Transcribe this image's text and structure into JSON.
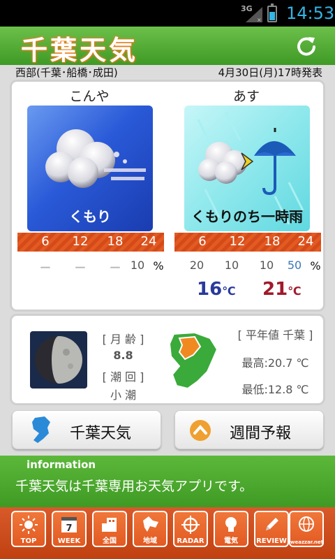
{
  "status_bar": {
    "network": "3G",
    "time": "14:53"
  },
  "header": {
    "title": "千葉天気",
    "refresh_icon": "refresh-icon"
  },
  "info_line": {
    "region": "西部(千葉･船橋･成田)",
    "issued": "4月30日(月)17時発表"
  },
  "forecast": {
    "today": {
      "label": "こんや",
      "weather": "くもり",
      "times": [
        "6",
        "12",
        "18",
        "24"
      ],
      "precip": [
        "ー",
        "ー",
        "ー",
        "10"
      ],
      "pct_unit": "%"
    },
    "tomorrow": {
      "label": "あす",
      "weather": "くもりのち一時雨",
      "times": [
        "6",
        "12",
        "18",
        "24"
      ],
      "precip": [
        "20",
        "10",
        "10",
        "50"
      ],
      "pct_unit": "%",
      "min_temp": "16",
      "max_temp": "21",
      "temp_unit": "℃"
    }
  },
  "moon": {
    "age_label": "[ 月 齢 ]",
    "age_value": "8.8",
    "tide_label": "[ 潮 回 ]",
    "tide_value": "小 潮"
  },
  "normal": {
    "label": "[ 平年値 千葉 ]",
    "high": "最高:20.7 ℃",
    "low": "最低:12.8 ℃"
  },
  "buttons": {
    "chiba": "千葉天気",
    "week": "週間予報"
  },
  "information": {
    "title": "information",
    "message": "千葉天気は千葉専用お天気アプリです。"
  },
  "tabs": [
    {
      "label": "TOP",
      "icon": "sun-icon"
    },
    {
      "label": "WEEK",
      "icon": "calendar-icon",
      "badge": "7"
    },
    {
      "label": "全国",
      "icon": "building-icon"
    },
    {
      "label": "地域",
      "icon": "hokkaido-icon"
    },
    {
      "label": "RADAR",
      "icon": "crosshair-icon"
    },
    {
      "label": "電気",
      "icon": "lightbulb-icon"
    },
    {
      "label": "REVIEW",
      "icon": "pencil-icon"
    },
    {
      "label": "weazzar.net",
      "icon": "globe-icon"
    }
  ],
  "colors": {
    "header_green": "#4aa82e",
    "orange_bar": "#e35a22",
    "min_blue": "#2a3a9a",
    "max_red": "#a01a2a"
  }
}
